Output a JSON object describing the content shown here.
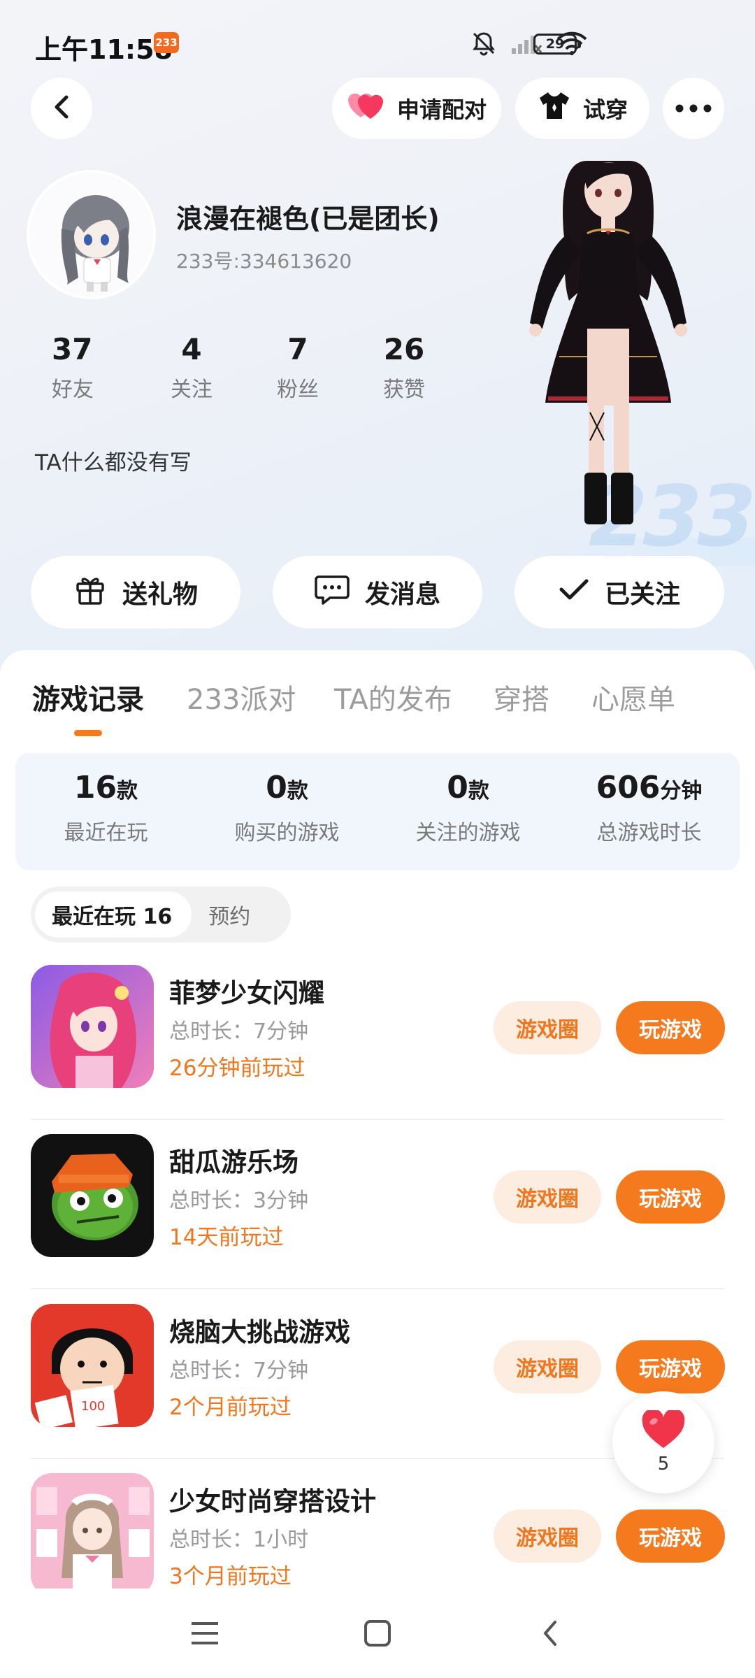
{
  "status_bar": {
    "time": "上午11:58",
    "badge": "233",
    "battery": "29"
  },
  "top_nav": {
    "pair_label": "申请配对",
    "try_on_label": "试穿"
  },
  "profile": {
    "name": "浪漫在褪色(已是团长)",
    "id_text": "233号:334613620",
    "bio": "TA什么都没有写",
    "stats": [
      {
        "value": "37",
        "label": "好友"
      },
      {
        "value": "4",
        "label": "关注"
      },
      {
        "value": "7",
        "label": "粉丝"
      },
      {
        "value": "26",
        "label": "获赞"
      }
    ]
  },
  "actions": {
    "gift": "送礼物",
    "message": "发消息",
    "followed": "已关注"
  },
  "tabs": [
    "游戏记录",
    "233派对",
    "TA的发布",
    "穿搭",
    "心愿单"
  ],
  "summary": [
    {
      "value": "16",
      "unit": "款",
      "label": "最近在玩"
    },
    {
      "value": "0",
      "unit": "款",
      "label": "购买的游戏"
    },
    {
      "value": "0",
      "unit": "款",
      "label": "关注的游戏"
    },
    {
      "value": "606",
      "unit": "分钟",
      "label": "总游戏时长"
    }
  ],
  "filter": {
    "recent": "最近在玩 16",
    "reserve": "预约"
  },
  "games": [
    {
      "title": "菲梦少女闪耀",
      "duration": "总时长：7分钟",
      "last_played": "26分钟前玩过",
      "circle_label": "游戏圈",
      "play_label": "玩游戏"
    },
    {
      "title": "甜瓜游乐场",
      "duration": "总时长：3分钟",
      "last_played": "14天前玩过",
      "circle_label": "游戏圈",
      "play_label": "玩游戏"
    },
    {
      "title": "烧脑大挑战游戏",
      "duration": "总时长：7分钟",
      "last_played": "2个月前玩过",
      "circle_label": "游戏圈",
      "play_label": "玩游戏"
    },
    {
      "title": "少女时尚穿搭设计",
      "duration": "总时长：1小时",
      "last_played": "3个月前玩过",
      "circle_label": "游戏圈",
      "play_label": "玩游戏"
    }
  ],
  "like_fab": {
    "count": "5"
  },
  "colors": {
    "accent": "#f57a1e",
    "accent_light": "#fdece0",
    "summary_bg": "#f1f6fd"
  }
}
